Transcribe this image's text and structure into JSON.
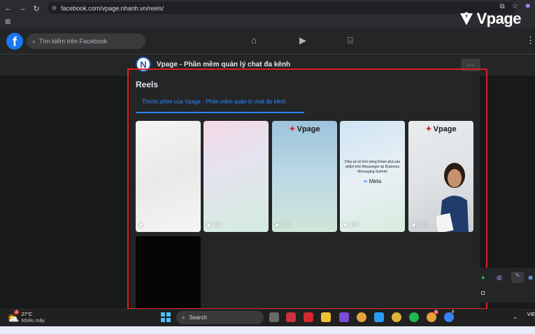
{
  "browser": {
    "url": "facebook.com/vpage.nhanh.vn/reels/",
    "watermark": "Vpage"
  },
  "fb": {
    "logo": "f",
    "search_placeholder": "Tìm kiếm trên Facebook",
    "nav_icons": [
      "home-icon",
      "video-icon",
      "marketplace-icon"
    ]
  },
  "page": {
    "avatar_letter": "N",
    "name": "Vpage - Phần mềm quản lý chat đa kênh",
    "more": "···"
  },
  "reels": {
    "title": "Reels",
    "tab": "Thước phim của Vpage - Phần mềm quản lý chat đa kênh",
    "items": [
      {
        "views": ""
      },
      {
        "views": "227"
      },
      {
        "views": "274",
        "logo": "Vpage"
      },
      {
        "views": "185",
        "text": "Chia sẻ về tính năng Khám phá sản phẩm trên Messenger tại Business Messaging Summit",
        "brand": "Meta"
      },
      {
        "views": "371",
        "logo": "Vpage"
      }
    ]
  },
  "taskbar": {
    "temperature": "27°C",
    "weather_desc": "Nhiều mây",
    "search": "Search",
    "lang": "VIE",
    "badges": [
      "2",
      "8",
      "8"
    ]
  },
  "colors": {
    "accent": "#2d88ff",
    "highlight_box": "#e01e1e",
    "fb_blue": "#1877f2"
  }
}
